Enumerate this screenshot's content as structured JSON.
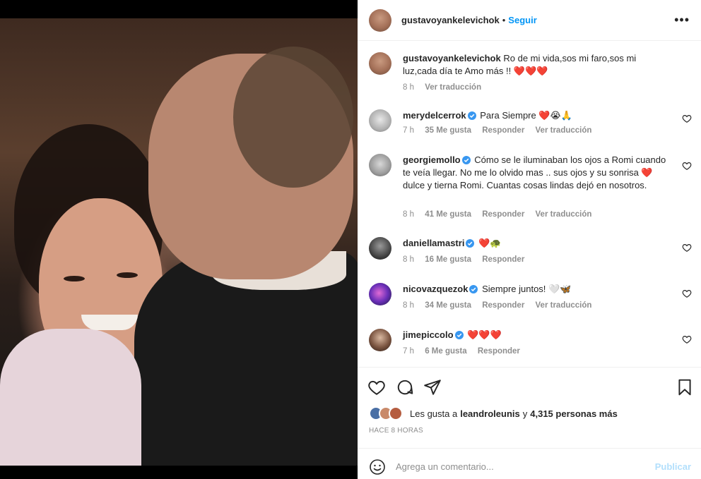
{
  "post": {
    "author": "gustavoyankelevichok",
    "separator": "•",
    "follow_label": "Seguir",
    "more_label": "•••"
  },
  "caption": {
    "author": "gustavoyankelevichok",
    "text": "Ro de mi vida,sos mi faro,sos mi luz,cada día te Amo más !! ❤️❤️❤️",
    "time": "8 h",
    "translate": "Ver traducción"
  },
  "comments": [
    {
      "user": "merydelcerrok",
      "text": "Para Siempre ❤️😭🙏",
      "time": "7 h",
      "likes": "35 Me gusta",
      "reply": "Responder",
      "translate": "Ver traducción"
    },
    {
      "user": "georgiemollo",
      "text": "Cómo se le iluminaban los ojos a Romi cuando te veía llegar. No me lo olvido mas .. sus ojos y su sonrisa ❤️ dulce y tierna Romi. Cuantas cosas lindas dejó en nosotros.",
      "time": "8 h",
      "likes": "41 Me gusta",
      "reply": "Responder",
      "translate": "Ver traducción"
    },
    {
      "user": "daniellamastri",
      "text": "❤️🐢",
      "time": "8 h",
      "likes": "16 Me gusta",
      "reply": "Responder"
    },
    {
      "user": "nicovazquezok",
      "text": "Siempre juntos! 🤍🦋",
      "time": "8 h",
      "likes": "34 Me gusta",
      "reply": "Responder",
      "translate": "Ver traducción"
    },
    {
      "user": "jimepiccolo",
      "text": "❤️❤️❤️",
      "time": "7 h",
      "likes": "6 Me gusta",
      "reply": "Responder"
    }
  ],
  "likes": {
    "prefix": "Les gusta a",
    "user": "leandroleunis",
    "connector": "y",
    "count": "4,315 personas más"
  },
  "time_ago": "HACE 8 HORAS",
  "add_comment": {
    "placeholder": "Agrega un comentario...",
    "publish": "Publicar"
  },
  "icons": [
    "heart-icon",
    "comment-icon",
    "share-icon",
    "bookmark-icon",
    "emoji-icon",
    "verified-icon",
    "more-icon"
  ],
  "colors": {
    "link": "#0095f6",
    "verified": "#3897f0",
    "muted": "#8e8e8e",
    "publish_disabled": "#b2dffc",
    "heart": "#e02020"
  }
}
